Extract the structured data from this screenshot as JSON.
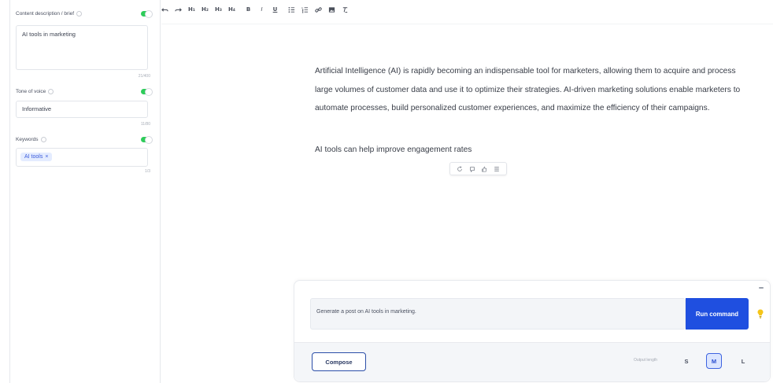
{
  "sidebar": {
    "content": {
      "label": "Content description / brief",
      "value": "AI tools in marketing",
      "counter": "21/400"
    },
    "tone": {
      "label": "Tone of voice",
      "value": "Informative",
      "counter": "11/80"
    },
    "keywords": {
      "label": "Keywords",
      "chips": [
        {
          "label": "AI tools",
          "remove": "×"
        }
      ],
      "counter": "1/3"
    }
  },
  "toolbar": {
    "items": [
      "undo-icon",
      "redo-icon",
      "H1",
      "H2",
      "H3",
      "H4",
      "B",
      "I",
      "U",
      "bullet-list-icon",
      "numbered-list-icon",
      "link-icon",
      "image-icon",
      "clear-format-icon"
    ],
    "h1": "H₁",
    "h2": "H₂",
    "h3": "H₃",
    "h4": "H₄",
    "bold": "B",
    "italic": "I",
    "underline": "U"
  },
  "editor": {
    "paragraph1": "Artificial Intelligence (AI) is rapidly becoming an indispensable tool for marketers, allowing them to acquire and process large volumes of customer data and use it to optimize their strategies. AI-driven marketing solutions enable marketers to automate processes, build personalized customer experiences, and maximize the efficiency of their campaigns.",
    "paragraph2": "AI tools can help improve engagement rates",
    "mini_toolbar": [
      "regenerate-icon",
      "comment-icon",
      "thumbs-up-icon",
      "list-icon"
    ]
  },
  "command": {
    "input_value": "Generate a post on AI tools in marketing.",
    "run_label": "Run command",
    "compose_label": "Compose",
    "output_length_label": "Output length",
    "lengths": [
      "S",
      "M",
      "L"
    ],
    "selected_length": "M"
  },
  "colors": {
    "accent": "#1f4fe0",
    "toggle_on": "#2ecc5a",
    "chip_bg": "#e4ecff",
    "bulb": "#f5c518"
  }
}
